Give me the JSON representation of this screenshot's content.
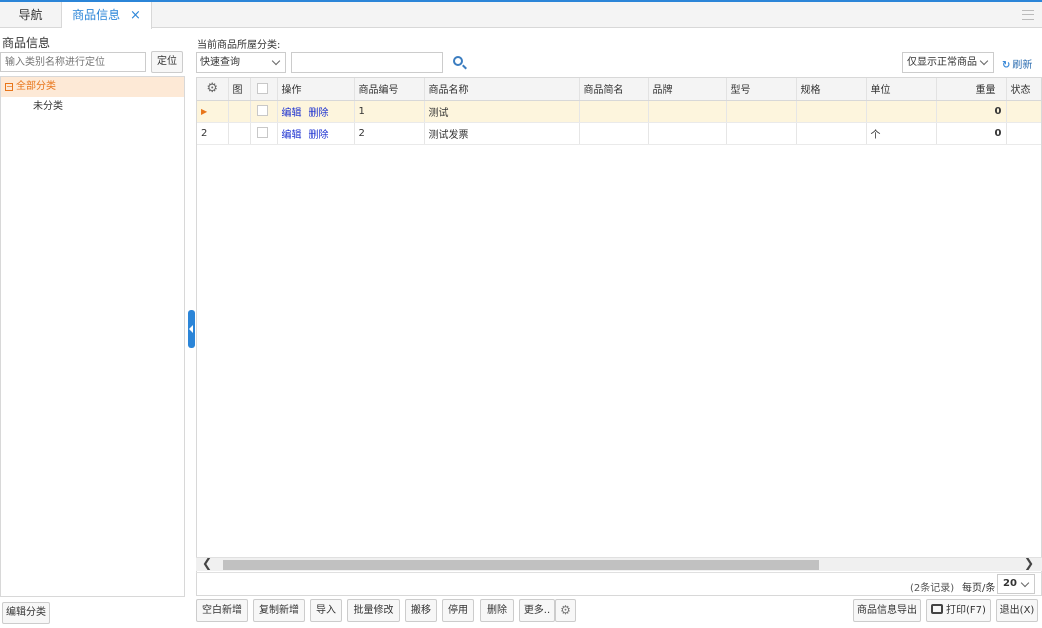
{
  "tabs": {
    "nav_label": "导航",
    "active_label": "商品信息",
    "close_glyph": "×"
  },
  "left": {
    "title": "商品信息",
    "search_placeholder": "输入类别名称进行定位",
    "locate_button": "定位",
    "tree": {
      "all_label": "全部分类",
      "sub_label": "未分类"
    },
    "edit_category_button": "编辑分类"
  },
  "toolbar": {
    "category_label": "当前商品所屋分类:",
    "quick_query": "快速查询",
    "filter_option": "仅显示正常商品",
    "refresh_label": "刷新"
  },
  "grid": {
    "columns": [
      "",
      "图",
      "",
      "操作",
      "商品编号",
      "商品名称",
      "商品简名",
      "品牌",
      "型号",
      "规格",
      "单位",
      "重量",
      "状态"
    ],
    "rows": [
      {
        "mark": "▶",
        "edit": "编辑",
        "delete": "删除",
        "code": "1",
        "name": "测试",
        "short": "",
        "brand": "",
        "model": "",
        "spec": "",
        "unit": "",
        "weight": "0",
        "status": ""
      },
      {
        "mark": "2",
        "edit": "编辑",
        "delete": "删除",
        "code": "2",
        "name": "测试发票",
        "short": "",
        "brand": "",
        "model": "",
        "spec": "",
        "unit": "个",
        "weight": "0",
        "status": ""
      }
    ]
  },
  "pager": {
    "count_text": "(2条记录)",
    "per_page_label": "每页/条",
    "page_size": "20"
  },
  "footer": {
    "blank_add": "空白新增",
    "copy_add": "复制新增",
    "import": "导入",
    "batch_edit": "批量修改",
    "move": "搬移",
    "disable": "停用",
    "delete": "删除",
    "more": "更多..",
    "export": "商品信息导出",
    "print": "打印(F7)",
    "exit": "退出(X)"
  },
  "icons": [
    "menu-icon",
    "close-icon",
    "search-icon",
    "refresh-icon",
    "gear-icon",
    "print-icon",
    "chevron-down-icon"
  ],
  "colors": {
    "accent": "#2b85d8",
    "selected_tree": "#fde9d6",
    "selected_row": "#fdf5dd",
    "link": "#1a2fd0"
  }
}
